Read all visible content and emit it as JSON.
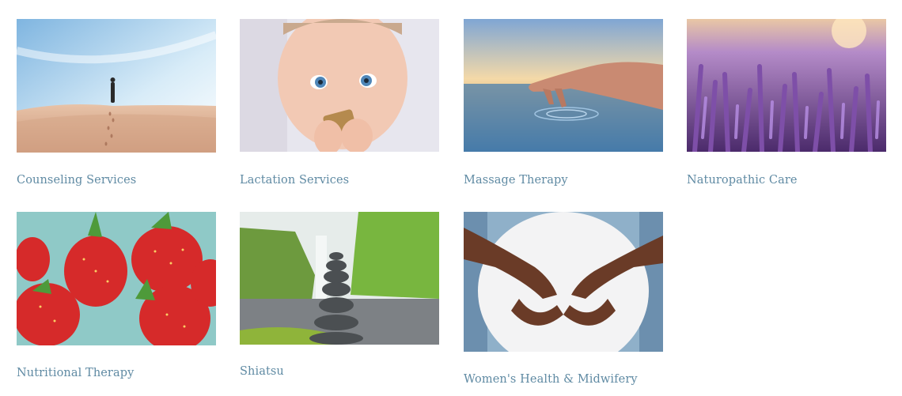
{
  "services": [
    {
      "label": "Counseling Services",
      "image": "person walking on desert dunes"
    },
    {
      "label": "Lactation Services",
      "image": "baby chewing wooden toy"
    },
    {
      "label": "Massage Therapy",
      "image": "hand touching calm water at sunset"
    },
    {
      "label": "Naturopathic Care",
      "image": "lavender field"
    },
    {
      "label": "Nutritional Therapy",
      "image": "fresh strawberries"
    },
    {
      "label": "Shiatsu",
      "image": "stacked stones with waterfall"
    },
    {
      "label": "Women's Health & Midwifery",
      "image": "hands forming heart on pregnant belly"
    }
  ]
}
